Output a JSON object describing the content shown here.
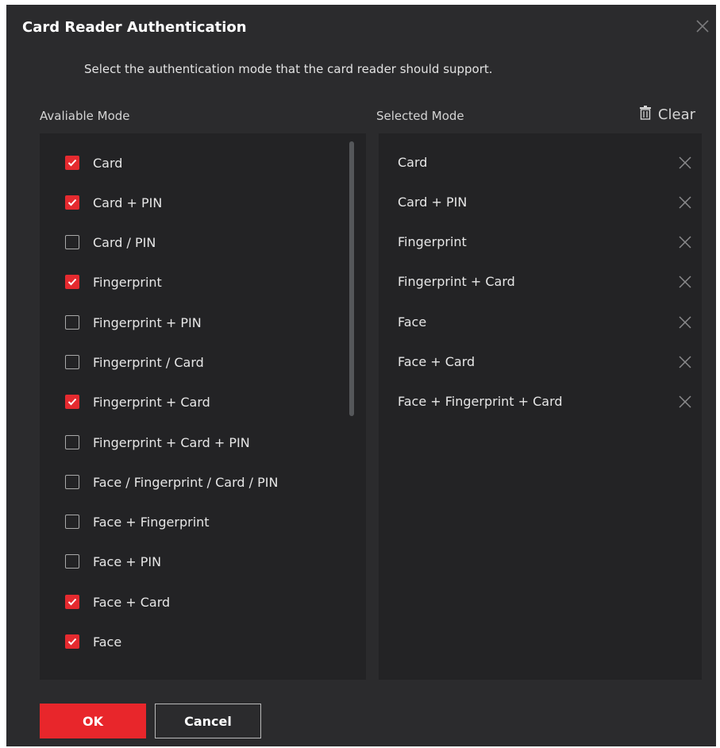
{
  "dialog": {
    "title": "Card Reader Authentication",
    "subtitle": "Select the authentication mode that the card reader should support.",
    "available_label": "Avaliable Mode",
    "selected_label": "Selected Mode",
    "clear_label": "Clear"
  },
  "available_modes": [
    {
      "label": "Card",
      "checked": true
    },
    {
      "label": "Card + PIN",
      "checked": true
    },
    {
      "label": "Card / PIN",
      "checked": false
    },
    {
      "label": "Fingerprint",
      "checked": true
    },
    {
      "label": "Fingerprint + PIN",
      "checked": false
    },
    {
      "label": "Fingerprint / Card",
      "checked": false
    },
    {
      "label": "Fingerprint + Card",
      "checked": true
    },
    {
      "label": "Fingerprint + Card + PIN",
      "checked": false
    },
    {
      "label": "Face / Fingerprint / Card / PIN",
      "checked": false
    },
    {
      "label": "Face + Fingerprint",
      "checked": false
    },
    {
      "label": "Face + PIN",
      "checked": false
    },
    {
      "label": "Face + Card",
      "checked": true
    },
    {
      "label": "Face",
      "checked": true
    }
  ],
  "selected_modes": [
    "Card",
    "Card + PIN",
    "Fingerprint",
    "Fingerprint + Card",
    "Face",
    "Face + Card",
    "Face + Fingerprint + Card"
  ],
  "buttons": {
    "ok": "OK",
    "cancel": "Cancel"
  },
  "colors": {
    "accent": "#e8262b",
    "background": "#2b2b2d",
    "panel": "#232325"
  }
}
